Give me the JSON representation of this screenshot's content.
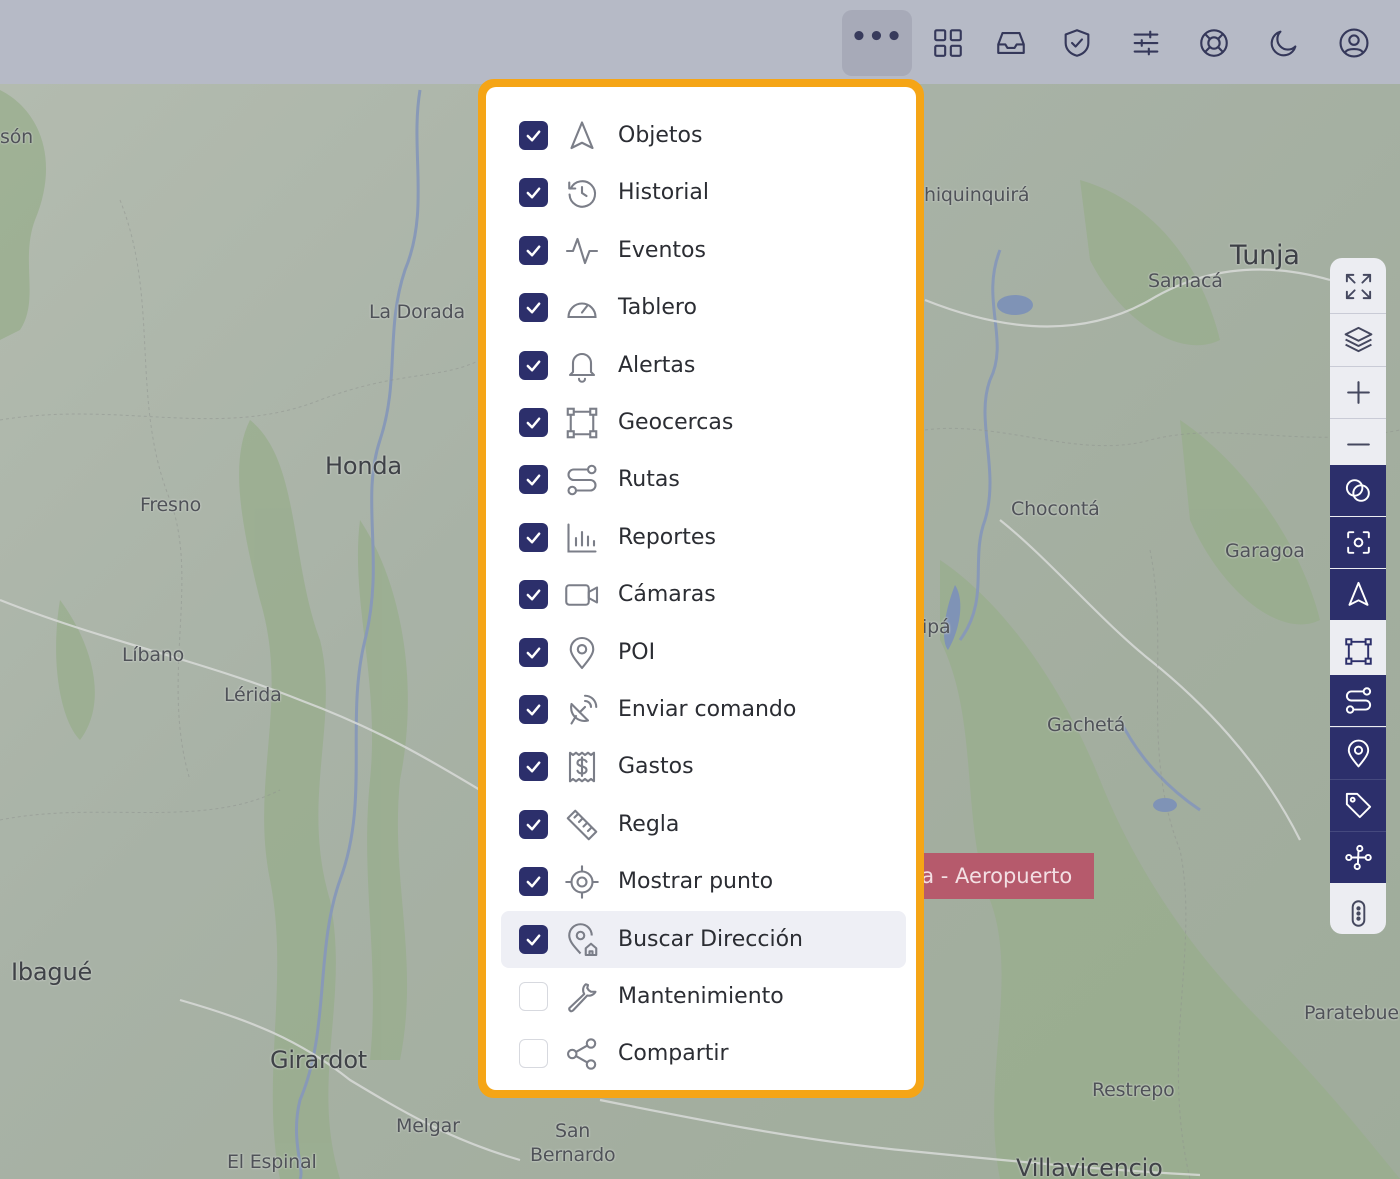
{
  "topbar": {
    "buttons": [
      {
        "id": "more",
        "icon": "more-dots-icon",
        "glyph": "•••",
        "active": true
      },
      {
        "id": "apps",
        "icon": "grid-icon"
      },
      {
        "id": "inbox",
        "icon": "inbox-icon"
      },
      {
        "id": "security",
        "icon": "shield-check-icon"
      },
      {
        "id": "settings",
        "icon": "sliders-icon"
      },
      {
        "id": "support",
        "icon": "lifebuoy-icon"
      },
      {
        "id": "theme",
        "icon": "moon-icon"
      },
      {
        "id": "account",
        "icon": "user-circle-icon"
      }
    ]
  },
  "menu": {
    "items": [
      {
        "label": "Objetos",
        "icon": "navigation-arrow-icon",
        "checked": true
      },
      {
        "label": "Historial",
        "icon": "history-icon",
        "checked": true
      },
      {
        "label": "Eventos",
        "icon": "activity-icon",
        "checked": true
      },
      {
        "label": "Tablero",
        "icon": "gauge-icon",
        "checked": true
      },
      {
        "label": "Alertas",
        "icon": "bell-icon",
        "checked": true
      },
      {
        "label": "Geocercas",
        "icon": "geofence-icon",
        "checked": true
      },
      {
        "label": "Rutas",
        "icon": "route-icon",
        "checked": true
      },
      {
        "label": "Reportes",
        "icon": "bar-chart-icon",
        "checked": true
      },
      {
        "label": "Cámaras",
        "icon": "video-camera-icon",
        "checked": true
      },
      {
        "label": "POI",
        "icon": "map-pin-icon",
        "checked": true
      },
      {
        "label": "Enviar comando",
        "icon": "satellite-dish-icon",
        "checked": true
      },
      {
        "label": "Gastos",
        "icon": "receipt-dollar-icon",
        "checked": true
      },
      {
        "label": "Regla",
        "icon": "ruler-icon",
        "checked": true
      },
      {
        "label": "Mostrar punto",
        "icon": "crosshair-icon",
        "checked": true
      },
      {
        "label": "Buscar Dirección",
        "icon": "location-search-icon",
        "checked": true,
        "highlighted": true
      },
      {
        "label": "Mantenimiento",
        "icon": "wrench-icon",
        "checked": false
      },
      {
        "label": "Compartir",
        "icon": "share-icon",
        "checked": false
      }
    ]
  },
  "side_toolbar": {
    "buttons": [
      {
        "icon": "fullscreen-icon",
        "dark": false
      },
      {
        "icon": "layers-icon",
        "dark": false
      },
      {
        "icon": "zoom-in-icon",
        "dark": false
      },
      {
        "icon": "zoom-out-icon",
        "dark": false
      },
      {
        "icon": "overlap-circles-icon",
        "dark": true
      },
      {
        "icon": "focus-icon",
        "dark": true
      },
      {
        "icon": "navigation-arrow-icon",
        "dark": true
      },
      {
        "icon": "geofence-icon",
        "dark": false
      },
      {
        "icon": "route-icon",
        "dark": true
      },
      {
        "icon": "map-pin-icon",
        "dark": true
      },
      {
        "icon": "tag-icon",
        "dark": true
      },
      {
        "icon": "path-icon",
        "dark": true
      },
      {
        "icon": "more-vertical-icon",
        "dark": false
      }
    ]
  },
  "map": {
    "labels": [
      {
        "text": "són",
        "size": "small"
      },
      {
        "text": "La Dorada",
        "size": "small"
      },
      {
        "text": "Honda",
        "size": "mid"
      },
      {
        "text": "Fresno",
        "size": "small"
      },
      {
        "text": "Líbano",
        "size": "small"
      },
      {
        "text": "Lérida",
        "size": "small"
      },
      {
        "text": "Ibagué",
        "size": "mid"
      },
      {
        "text": "Girardot",
        "size": "mid"
      },
      {
        "text": "Melgar",
        "size": "small"
      },
      {
        "text": "San",
        "size": "small"
      },
      {
        "text": "Bernardo",
        "size": "small"
      },
      {
        "text": "El Espinal",
        "size": "small"
      },
      {
        "text": "hiquinquirá",
        "size": "small"
      },
      {
        "text": "Tunja",
        "size": "big"
      },
      {
        "text": "Samacá",
        "size": "small"
      },
      {
        "text": "Chocontá",
        "size": "small"
      },
      {
        "text": "Garagoa",
        "size": "small"
      },
      {
        "text": "ipá",
        "size": "small"
      },
      {
        "text": "Gachetá",
        "size": "small"
      },
      {
        "text": "Paratebue",
        "size": "small"
      },
      {
        "text": "Restrepo",
        "size": "small"
      },
      {
        "text": "Villavicencio",
        "size": "mid"
      }
    ],
    "marker_label": "ta - Aeropuerto"
  },
  "colors": {
    "accent": "#2c2f6b",
    "panel_border": "#f5a516",
    "highlight": "#eeeff5",
    "marker": "#b65a6c"
  }
}
